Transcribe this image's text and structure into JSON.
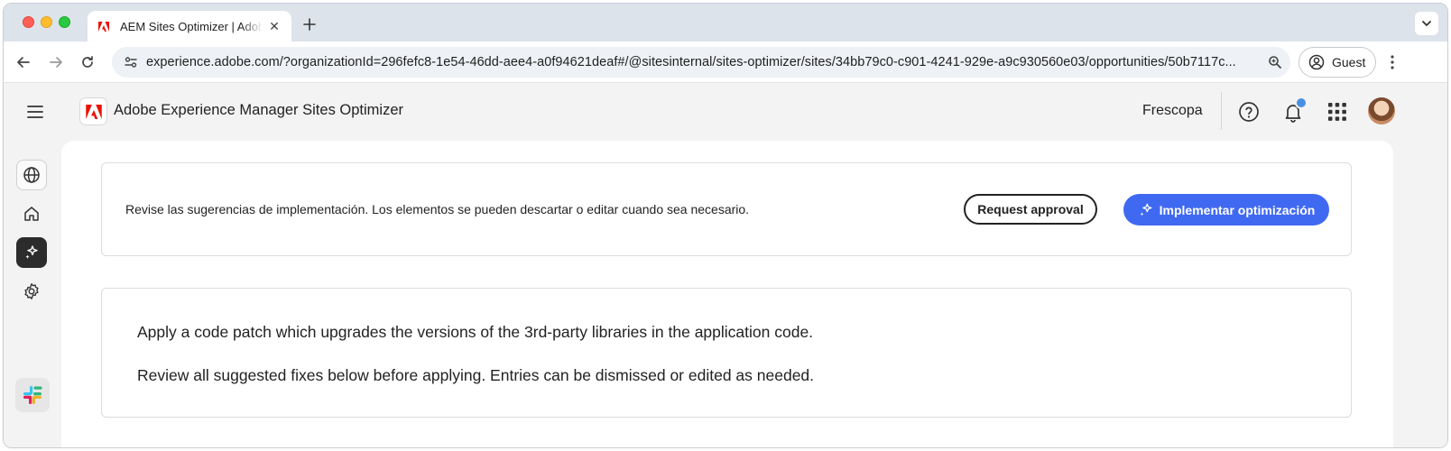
{
  "browser": {
    "tab_title": "AEM Sites Optimizer | Adobe Experience Manager",
    "url": "experience.adobe.com/?organizationId=296fefc8-1e54-46dd-aee4-a0f94621deaf#/@sitesinternal/sites-optimizer/sites/34bb79c0-c901-4241-929e-a9c930560e03/opportunities/50b7117c...",
    "profile_label": "Guest"
  },
  "app": {
    "title": "Adobe Experience Manager Sites Optimizer",
    "org_name": "Frescopa",
    "accent_color": "#4069f2",
    "logo_color": "#eb1000"
  },
  "sidebar": {
    "items": [
      {
        "name": "globe",
        "icon": "globe-icon"
      },
      {
        "name": "home",
        "icon": "home-icon"
      },
      {
        "name": "opportunities",
        "icon": "sparkle-icon",
        "active": true
      },
      {
        "name": "settings",
        "icon": "gear-icon"
      },
      {
        "name": "slack",
        "icon": "slack-icon"
      }
    ]
  },
  "suggestions_card": {
    "info_text": "Revise las sugerencias de implementación. Los elementos se pueden descartar o editar cuando sea necesario.",
    "request_approval_label": "Request approval",
    "implement_label": "Implementar optimización"
  },
  "description_card": {
    "line1": "Apply a code patch which upgrades the versions of the 3rd-party libraries in the application code.",
    "line2": "Review all suggested fixes below before applying. Entries can be dismissed or edited as needed."
  }
}
